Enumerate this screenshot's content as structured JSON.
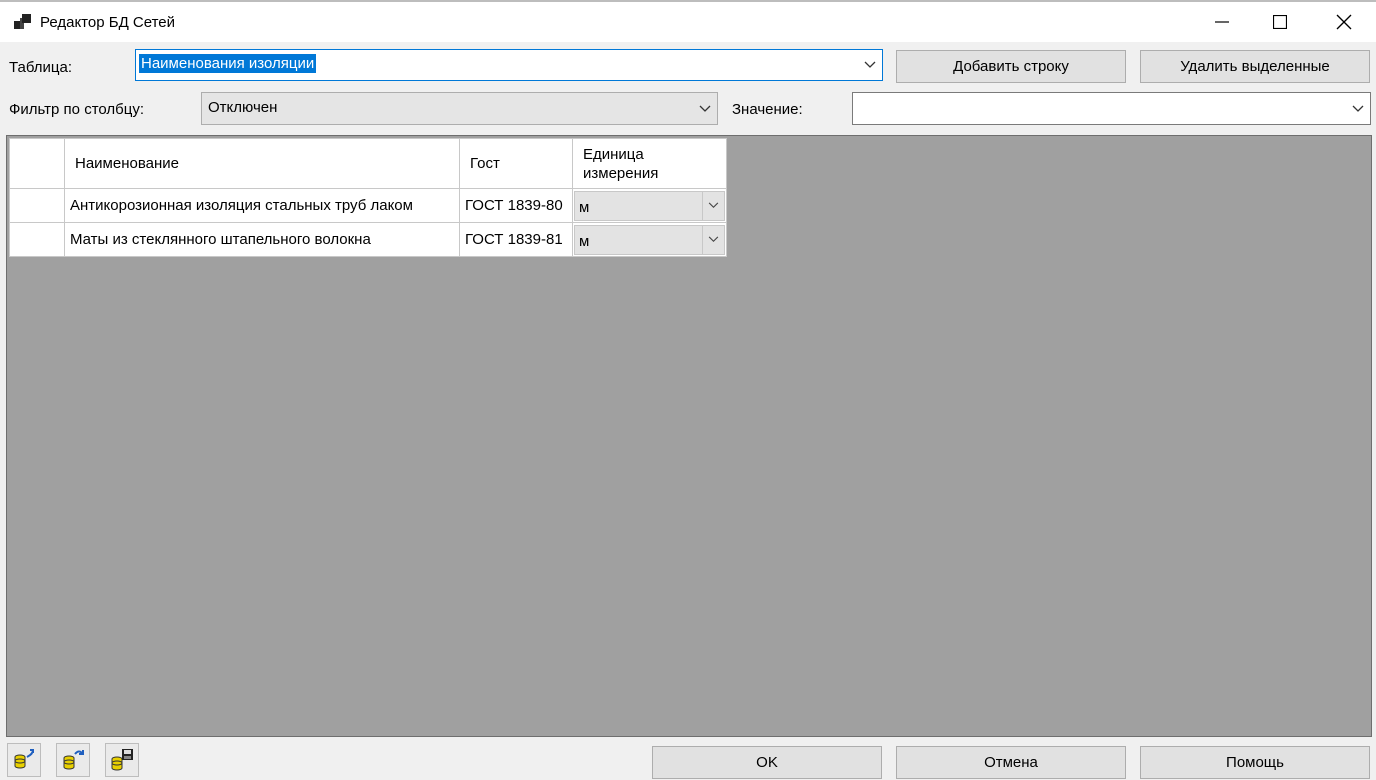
{
  "window": {
    "title": "Редактор БД Сетей"
  },
  "toolbar": {
    "table_label": "Таблица:",
    "table_value": "Наименования изоляции",
    "add_row": "Добавить строку",
    "delete_selected": "Удалить выделенные",
    "filter_label": "Фильтр по столбцу:",
    "filter_value": "Отключен",
    "value_label": "Значение:",
    "value_value": ""
  },
  "grid": {
    "columns": [
      "Наименование",
      "Гост",
      "Единица измерения"
    ],
    "rows": [
      {
        "name": "Антикорозионная изоляция стальных труб лаком",
        "gost": "ГОСТ 1839-80",
        "unit": "м"
      },
      {
        "name": "Маты из стеклянного штапельного волокна",
        "gost": "ГОСТ 1839-81",
        "unit": "м"
      }
    ]
  },
  "footer": {
    "ok": "OK",
    "cancel": "Отмена",
    "help": "Помощь"
  },
  "icons": [
    "app-icon",
    "minimize-icon",
    "maximize-icon",
    "close-icon",
    "db-import-icon",
    "db-refresh-icon",
    "db-save-icon"
  ],
  "colors": {
    "selection": "#0078d7",
    "grid_background": "#a0a0a0",
    "button": "#e1e1e1"
  }
}
